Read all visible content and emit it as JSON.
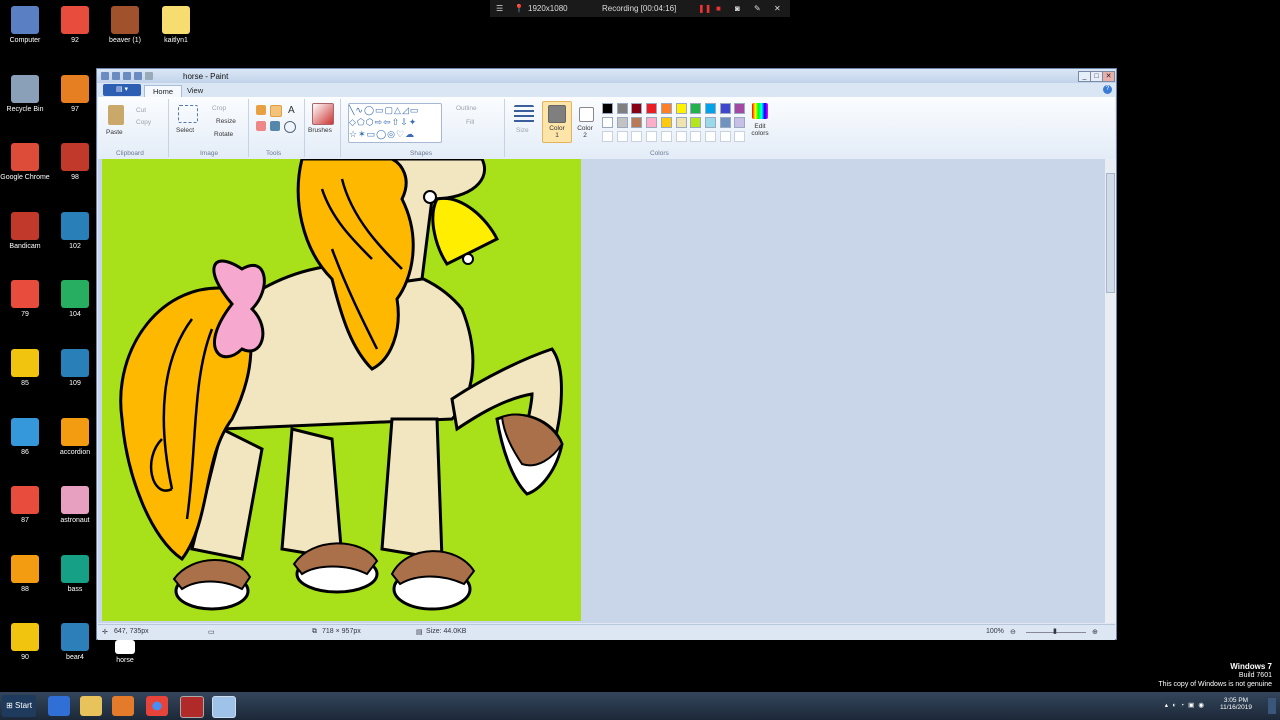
{
  "desktop": {
    "left_column": [
      {
        "label": "Computer",
        "color": "#5a7fc2"
      },
      {
        "label": "Recycle Bin",
        "color": "#8aa0b8"
      },
      {
        "label": "Google Chrome",
        "color": "#dd4b39"
      },
      {
        "label": "Bandicam",
        "color": "#c0392b"
      },
      {
        "label": "79",
        "color": "#e74c3c"
      },
      {
        "label": "85",
        "color": "#f1c40f"
      },
      {
        "label": "86",
        "color": "#3498db"
      },
      {
        "label": "87",
        "color": "#e74c3c"
      },
      {
        "label": "88",
        "color": "#f39c12"
      },
      {
        "label": "90",
        "color": "#f1c40f"
      }
    ],
    "right_column": [
      {
        "label": "92",
        "color": "#e74c3c"
      },
      {
        "label": "97",
        "color": "#e67e22"
      },
      {
        "label": "98",
        "color": "#c0392b"
      },
      {
        "label": "102",
        "color": "#2980b9"
      },
      {
        "label": "104",
        "color": "#27ae60"
      },
      {
        "label": "109",
        "color": "#2980b9"
      },
      {
        "label": "accordion",
        "color": "#f39c12"
      },
      {
        "label": "astronaut",
        "color": "#e8a0c0"
      },
      {
        "label": "bass",
        "color": "#16a085"
      },
      {
        "label": "bear4",
        "color": "#2c7fb8"
      }
    ],
    "top_row": [
      {
        "label": "beaver (1)",
        "color": "#a0522d"
      },
      {
        "label": "kaitlyn1",
        "color": "#f7dc6f"
      }
    ],
    "bottom_file": "horse"
  },
  "recorder": {
    "resolution": "1920x1080",
    "status": "Recording [00:04:16]"
  },
  "window": {
    "title": "horse - Paint",
    "tabs": [
      {
        "label": "Home"
      },
      {
        "label": "View"
      }
    ],
    "ribbon": {
      "clipboard": {
        "paste": "Paste",
        "cut": "Cut",
        "copy": "Copy",
        "group": "Clipboard"
      },
      "image": {
        "select": "Select",
        "crop": "Crop",
        "resize": "Resize",
        "rotate": "Rotate",
        "group": "Image"
      },
      "tools": {
        "group": "Tools"
      },
      "brushes": {
        "label": "Brushes"
      },
      "shapes": {
        "outline": "Outline",
        "fill": "Fill",
        "group": "Shapes"
      },
      "size": {
        "label": "Size"
      },
      "color1": {
        "label": "Color 1",
        "value": "#7f7f7f"
      },
      "color2": {
        "label": "Color 2",
        "value": "#ffffff"
      },
      "colors": {
        "group": "Colors",
        "edit": "Edit colors"
      }
    },
    "palette_row1": [
      "#000000",
      "#7f7f7f",
      "#880015",
      "#ed1c24",
      "#ff7f27",
      "#fff200",
      "#22b14c",
      "#00a2e8",
      "#3f48cc",
      "#a349a4"
    ],
    "palette_row2": [
      "#ffffff",
      "#c3c3c3",
      "#b97a57",
      "#ffaec9",
      "#ffc90e",
      "#efe4b0",
      "#b5e61d",
      "#99d9ea",
      "#7092be",
      "#c8bfe7"
    ],
    "status": {
      "cursor": "647, 735px",
      "dimensions": "718 × 957px",
      "size": "Size: 44.0KB",
      "zoom": "100%"
    }
  },
  "taskbar": {
    "start": "Start",
    "time": "3:05 PM",
    "date": "11/16/2019"
  },
  "watermark": {
    "line1": "Windows 7",
    "line2": "Build 7601",
    "line3": "This copy of Windows is not genuine"
  }
}
